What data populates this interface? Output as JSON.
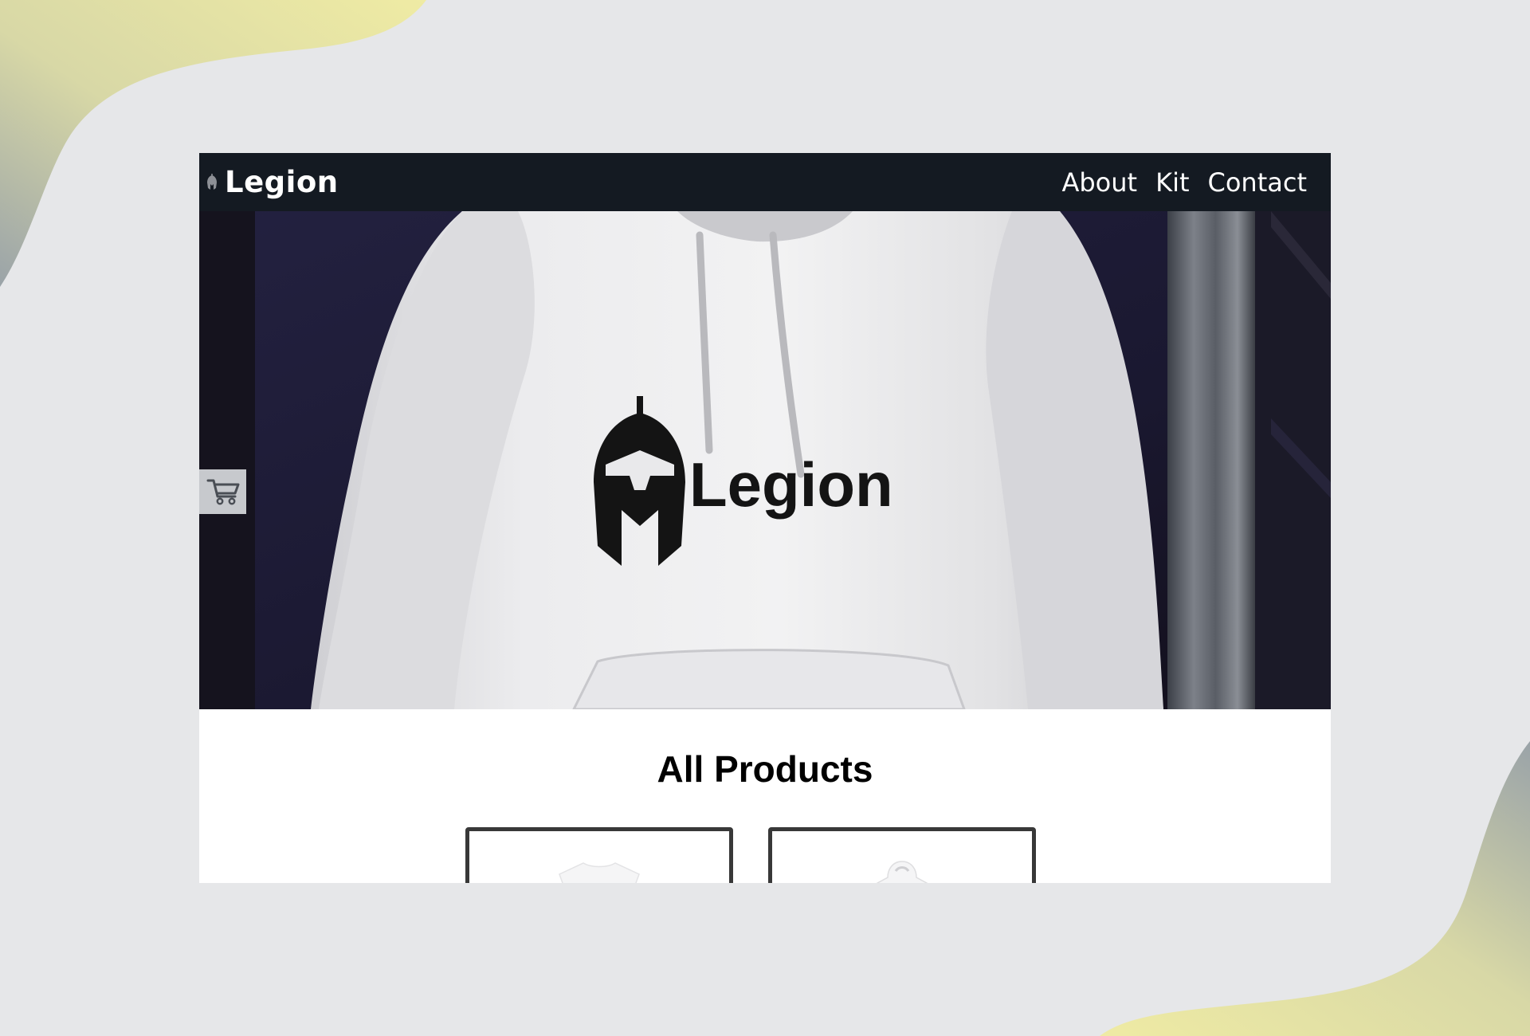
{
  "nav": {
    "brand": "Legion",
    "links": [
      "About",
      "Kit",
      "Contact"
    ]
  },
  "hero": {
    "print_text": "Legion",
    "image": "white hoodie with Legion spartan-helmet logo"
  },
  "cart": {
    "icon": "cart-icon"
  },
  "products": {
    "title": "All Products",
    "items": [
      {
        "image": "white t-shirt"
      },
      {
        "image": "white hoodie"
      }
    ]
  },
  "colors": {
    "navbar": "#141a22",
    "page_background": "#e6e7e9",
    "accent_blob": "#e9e7a3"
  }
}
